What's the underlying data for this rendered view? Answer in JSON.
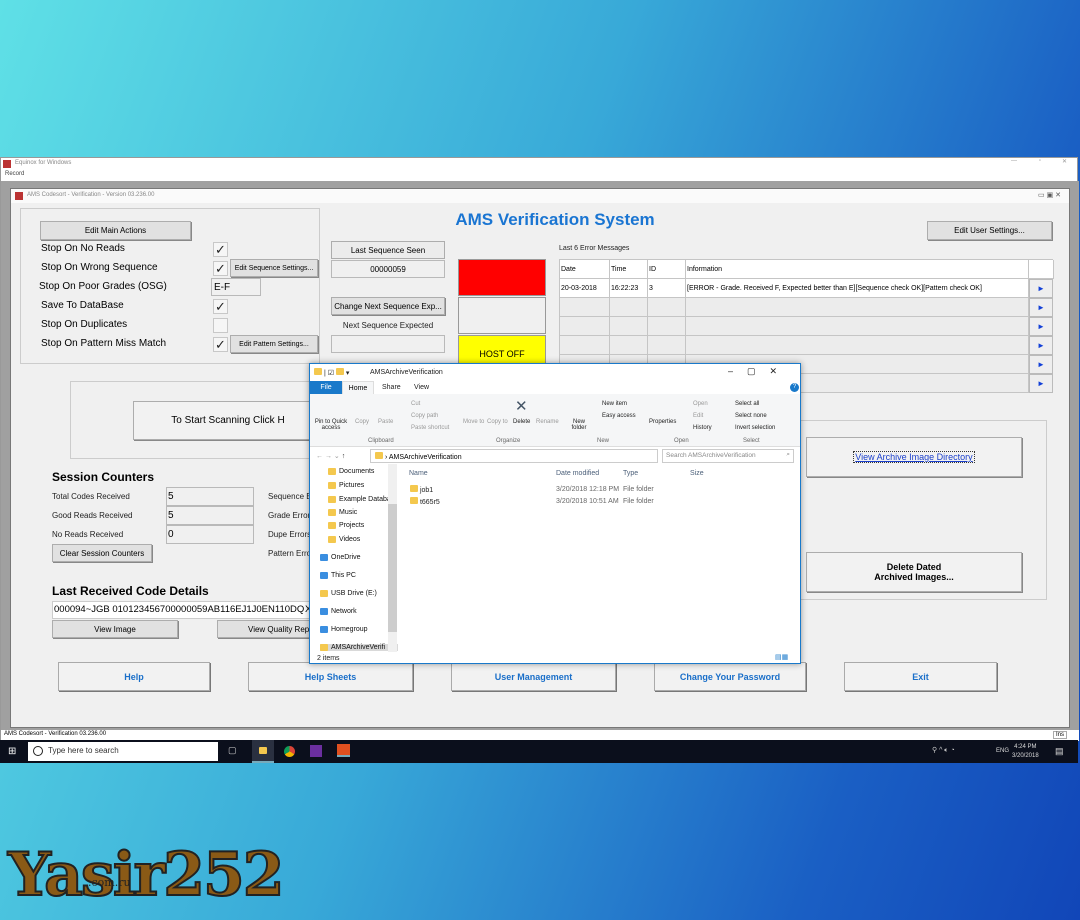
{
  "outer_window": {
    "title": "Equinox for Windows",
    "menu": [
      "Record"
    ],
    "status_text": "AMS Codesort - Verification 03.236.00",
    "status_mode": "Ins"
  },
  "app": {
    "window_title": "AMS Codesort - Verification - Version 03.236.00",
    "title": "AMS Verification System",
    "title_color": "#1a75d2",
    "edit_main_actions": "Edit Main Actions",
    "edit_user_settings": "Edit User Settings...",
    "options": [
      {
        "label": "Stop On No Reads",
        "checked": true
      },
      {
        "label": "Stop On Wrong Sequence",
        "checked": true
      },
      {
        "label": "Stop On Poor Grades (OSG)",
        "value": "E-F"
      },
      {
        "label": "Save To DataBase",
        "checked": true
      },
      {
        "label": "Stop On Duplicates",
        "checked": false
      },
      {
        "label": "Stop On Pattern Miss Match",
        "checked": true
      }
    ],
    "check_glyph": "✓",
    "edit_sequence_settings": "Edit Sequence Settings...",
    "edit_pattern_settings": "Edit Pattern Settings...",
    "last_sequence_seen_label": "Last Sequence Seen",
    "last_sequence_seen_value": "00000059",
    "change_next_sequence": "Change Next Sequence Exp...",
    "next_sequence_expected_label": "Next Sequence Expected",
    "next_sequence_expected_value": "",
    "status_lights": {
      "top_color": "#ff0000",
      "middle_color": "#f0f0f0",
      "bottom_color": "#ffff00",
      "bottom_label": "HOST OFF"
    },
    "errors": {
      "label": "Last 6 Error Messages",
      "columns": [
        "Date",
        "Time",
        "ID",
        "Information"
      ],
      "rows": [
        [
          "20-03-2018",
          "16:22:23",
          "3",
          "[ERROR - Grade. Received F, Expected better than E][Sequence check OK][Pattern check OK]"
        ],
        [
          "",
          "",
          "",
          ""
        ],
        [
          "",
          "",
          "",
          ""
        ],
        [
          "",
          "",
          "",
          ""
        ],
        [
          "",
          "",
          "",
          ""
        ],
        [
          "",
          "",
          "",
          ""
        ]
      ],
      "arrow": "►"
    },
    "start_scanning": "To Start Scanning Click H",
    "view_archive": "View Archive Image Directory",
    "delete_archived": "Delete Dated\nArchived Images...",
    "session": {
      "title": "Session Counters",
      "counters": [
        {
          "label": "Total Codes Received",
          "value": "5"
        },
        {
          "label": "Good Reads Received",
          "value": "5"
        },
        {
          "label": "No Reads Received",
          "value": "0"
        }
      ],
      "error_labels": [
        "Sequence E",
        "Grade Errors",
        "Dupe Errors",
        "Pattern Errors"
      ],
      "clear": "Clear Session Counters"
    },
    "last_code": {
      "title": "Last Received Code Details",
      "value": "000094~JGB 010123456700000059AB116EJ1J0EN110DQ",
      "trail": "X",
      "view_image": "View Image",
      "view_quality": "View Quality Repo"
    },
    "bottom_buttons": [
      "Help",
      "Help Sheets",
      "User Management",
      "Change Your Password",
      "Exit"
    ]
  },
  "explorer": {
    "title": "AMSArchiveVerification",
    "tabs": [
      "File",
      "Home",
      "Share",
      "View"
    ],
    "ribbon": {
      "clipboard": {
        "label": "Clipboard",
        "items": [
          "Pin to Quick access",
          "Copy",
          "Paste",
          "Cut",
          "Copy path",
          "Paste shortcut"
        ]
      },
      "organize": {
        "label": "Organize",
        "items": [
          "Move to",
          "Copy to",
          "Delete",
          "Rename"
        ]
      },
      "new": {
        "label": "New",
        "items": [
          "New folder",
          "New item",
          "Easy access"
        ]
      },
      "open": {
        "label": "Open",
        "items": [
          "Properties",
          "Open",
          "Edit",
          "History"
        ]
      },
      "select": {
        "label": "Select",
        "items": [
          "Select all",
          "Select none",
          "Invert selection"
        ]
      }
    },
    "path": "AMSArchiveVerification",
    "search_placeholder": "Search AMSArchiveVerification",
    "nav": [
      "Documents",
      "Pictures",
      "Example Databa",
      "Music",
      "Projects",
      "Videos",
      "OneDrive",
      "This PC",
      "USB Drive (E:)",
      "Network",
      "Homegroup",
      "AMSArchiveVerifi"
    ],
    "columns": [
      "Name",
      "Date modified",
      "Type",
      "Size"
    ],
    "files": [
      {
        "name": "job1",
        "date": "3/20/2018 12:18 PM",
        "type": "File folder"
      },
      {
        "name": "t665r5",
        "date": "3/20/2018 10:51 AM",
        "type": "File folder"
      }
    ],
    "status": "2 items"
  },
  "taskbar": {
    "search_placeholder": "Type here to search",
    "time": "4:24 PM",
    "date": "3/20/2018",
    "lang": "ENG"
  },
  "watermark": {
    "text": "Yasir252",
    "sub": ".com.ru"
  }
}
